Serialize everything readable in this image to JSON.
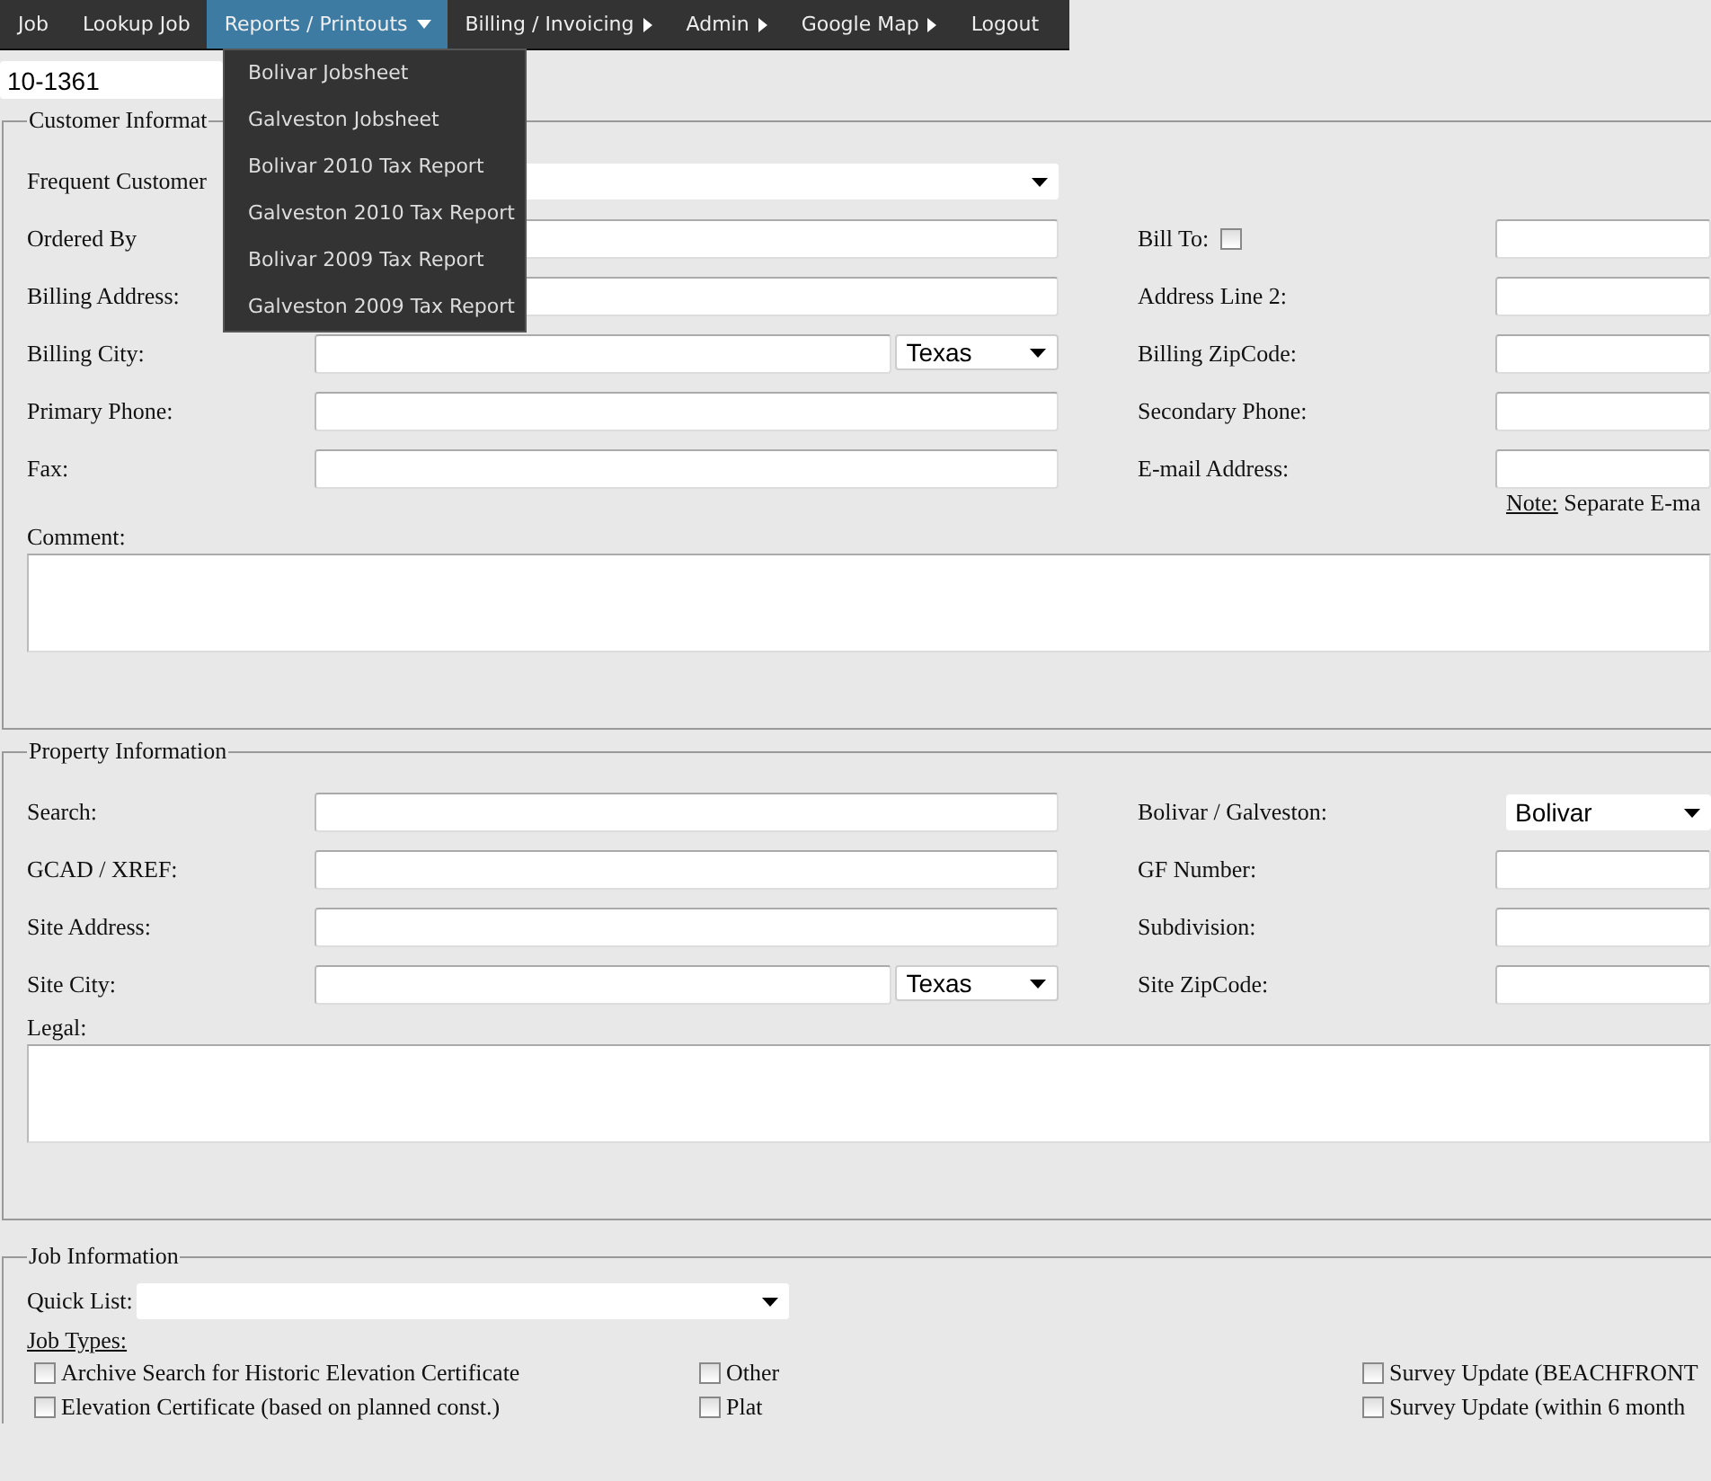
{
  "nav": [
    {
      "label": "Job",
      "kind": "link",
      "selected": false
    },
    {
      "label": "Lookup Job",
      "kind": "link",
      "selected": false
    },
    {
      "label": "Reports / Printouts",
      "kind": "dropdown",
      "selected": true
    },
    {
      "label": "Billing / Invoicing",
      "kind": "submenu",
      "selected": false
    },
    {
      "label": "Admin",
      "kind": "submenu",
      "selected": false
    },
    {
      "label": "Google Map",
      "kind": "submenu",
      "selected": false
    },
    {
      "label": "Logout",
      "kind": "link",
      "selected": false
    }
  ],
  "open_menu": {
    "items": [
      "Bolivar Jobsheet",
      "Galveston Jobsheet",
      "Bolivar 2010 Tax Report",
      "Galveston 2010 Tax Report",
      "Bolivar 2009 Tax Report",
      "Galveston 2009 Tax Report"
    ]
  },
  "job_number": {
    "value": "10-1361"
  },
  "customer_information": {
    "legend": "Customer Informat",
    "rows": [
      {
        "left": {
          "label": "Frequent Customer",
          "kind": "select"
        }
      },
      {
        "left": {
          "label": "Ordered By",
          "kind": "text"
        },
        "right": {
          "label": "Bill To:",
          "checkbox": {
            "checked": false
          },
          "kind": "text"
        }
      },
      {
        "left": {
          "label": "Billing Address:",
          "kind": "text"
        },
        "right": {
          "label": "Address Line 2:",
          "kind": "text"
        }
      },
      {
        "left": {
          "label": "Billing City:",
          "kind": "city",
          "value": "Texas"
        },
        "right": {
          "label": "Billing ZipCode:",
          "kind": "text"
        }
      },
      {
        "left": {
          "label": "Primary Phone:",
          "kind": "text"
        },
        "right": {
          "label": "Secondary Phone:",
          "kind": "text"
        }
      },
      {
        "left": {
          "label": "Fax:",
          "kind": "text"
        },
        "right": {
          "label": "E-mail Address:",
          "kind": "text"
        }
      }
    ],
    "note": {
      "label": "Note:",
      "text": "Separate E-ma"
    },
    "textarea_label": "Comment:"
  },
  "property_information": {
    "legend": "Property Information",
    "rows": [
      {
        "left": {
          "label": "Search:",
          "kind": "text"
        },
        "right": {
          "label": "Bolivar / Galveston:",
          "kind": "select",
          "value": "Bolivar"
        }
      },
      {
        "left": {
          "label": "GCAD / XREF:",
          "kind": "text"
        },
        "right": {
          "label": "GF Number:",
          "kind": "text"
        }
      },
      {
        "left": {
          "label": "Site Address:",
          "kind": "text"
        },
        "right": {
          "label": "Subdivision:",
          "kind": "text"
        }
      },
      {
        "left": {
          "label": "Site City:",
          "kind": "city",
          "value": "Texas"
        },
        "right": {
          "label": "Site ZipCode:",
          "kind": "text"
        }
      }
    ],
    "textarea_label": "Legal:"
  },
  "job_information": {
    "legend": "Job Information",
    "quick_list": {
      "label": "Quick List:"
    },
    "job_types_label": "Job Types:",
    "job_types": [
      [
        {
          "label": "Archive Search for Historic Elevation Certificate",
          "checked": false
        },
        {
          "label": "Elevation Certificate (based on planned const.)",
          "checked": false
        }
      ],
      [
        {
          "label": "Other",
          "checked": false
        },
        {
          "label": "Plat",
          "checked": false
        }
      ],
      [
        {
          "label": "Survey Update (BEACHFRONT",
          "checked": false
        },
        {
          "label": "Survey Update (within 6 month",
          "checked": false
        }
      ]
    ]
  }
}
